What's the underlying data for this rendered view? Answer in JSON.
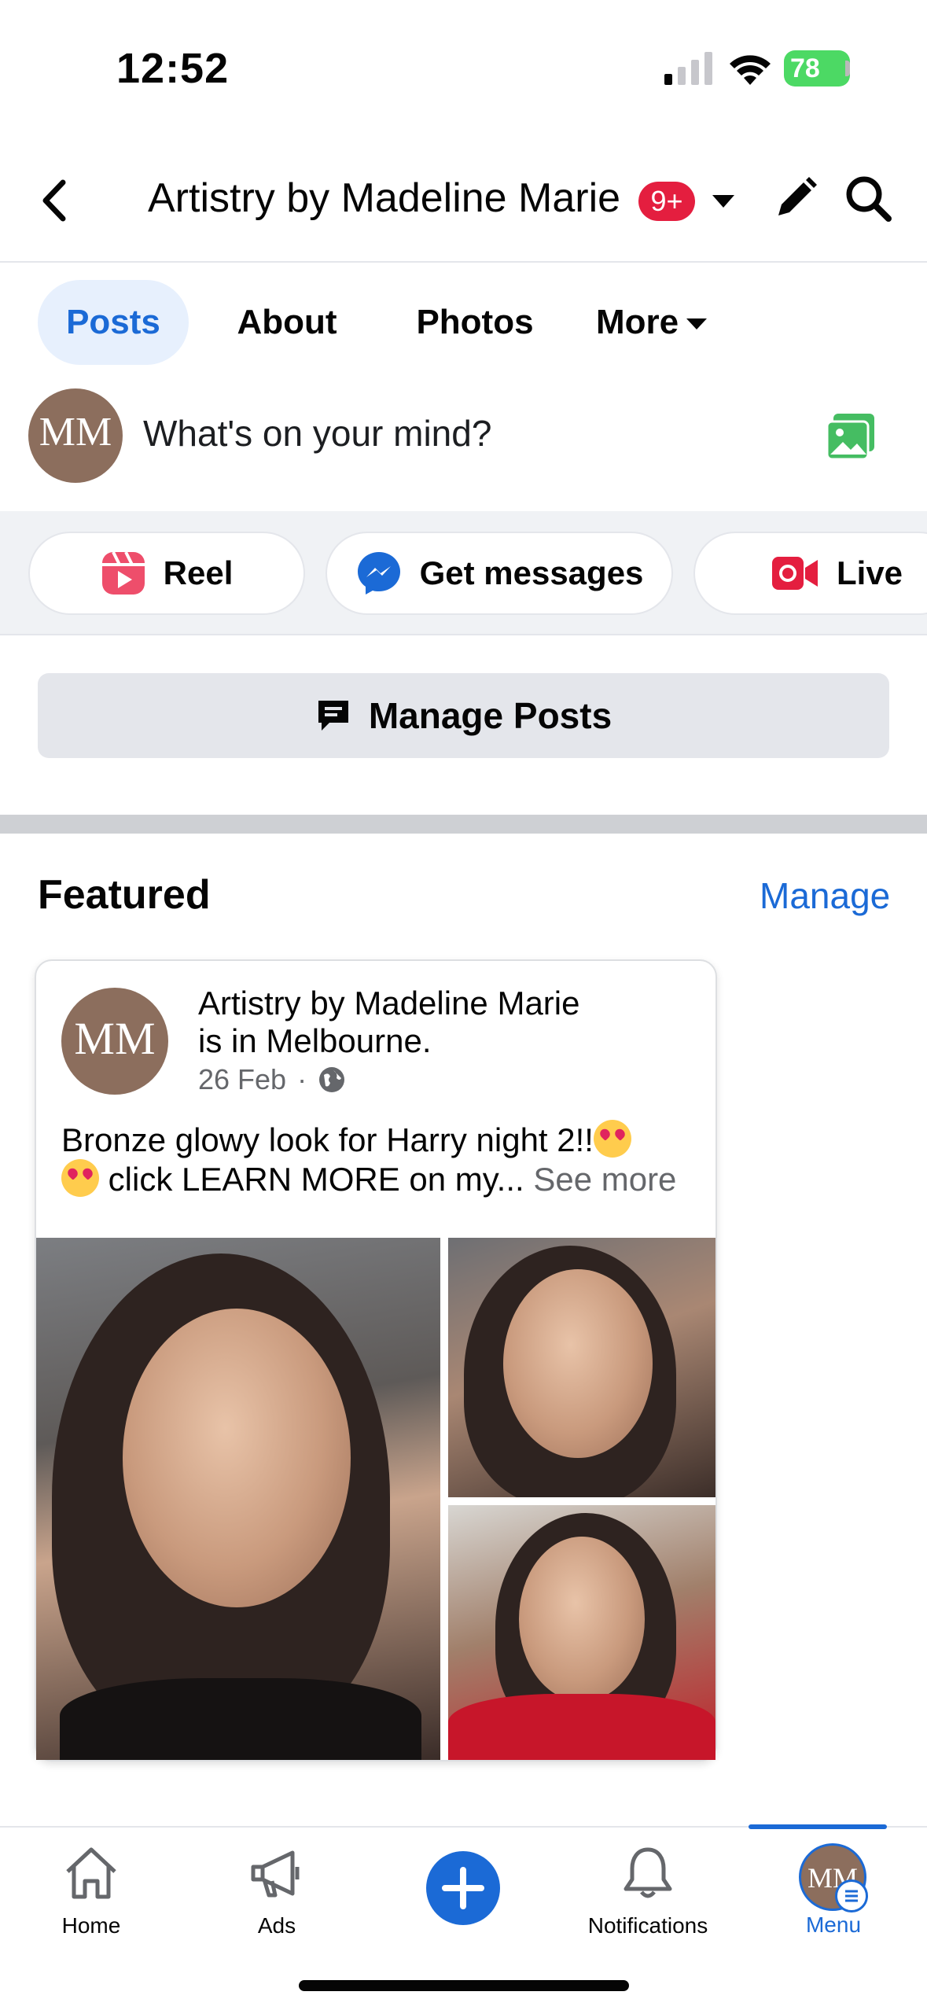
{
  "status_bar": {
    "time": "12:52",
    "battery": "78"
  },
  "header": {
    "title": "Artistry by Madeline Marie",
    "notification_badge": "9+"
  },
  "tabs": [
    {
      "label": "Posts",
      "active": true
    },
    {
      "label": "About"
    },
    {
      "label": "Photos"
    },
    {
      "label": "More"
    }
  ],
  "composer": {
    "avatar_text": "MM",
    "placeholder": "What's on your mind?"
  },
  "quick_actions": [
    {
      "label": "Reel",
      "icon": "reel-icon"
    },
    {
      "label": "Get messages",
      "icon": "messenger-icon"
    },
    {
      "label": "Live",
      "icon": "live-video-icon"
    }
  ],
  "manage_posts": {
    "label": "Manage Posts"
  },
  "featured": {
    "title": "Featured",
    "manage_label": "Manage",
    "post": {
      "author": "Artistry by Madeline Marie",
      "location_text": "is in Melbourne.",
      "date": "26 Feb",
      "text_line1": "Bronze glowy look for Harry night 2!!",
      "text_line2": "click LEARN MORE on my...",
      "see_more": "See more"
    }
  },
  "bottom_nav": [
    {
      "label": "Home",
      "icon": "home-icon"
    },
    {
      "label": "Ads",
      "icon": "megaphone-icon"
    },
    {
      "label": "",
      "icon": "plus-icon"
    },
    {
      "label": "Notifications",
      "icon": "bell-icon"
    },
    {
      "label": "Menu",
      "icon": "menu-avatar",
      "active": true
    }
  ],
  "colors": {
    "accent": "#1b6ad6",
    "badge": "#e41e3f",
    "battery": "#4cd964"
  }
}
